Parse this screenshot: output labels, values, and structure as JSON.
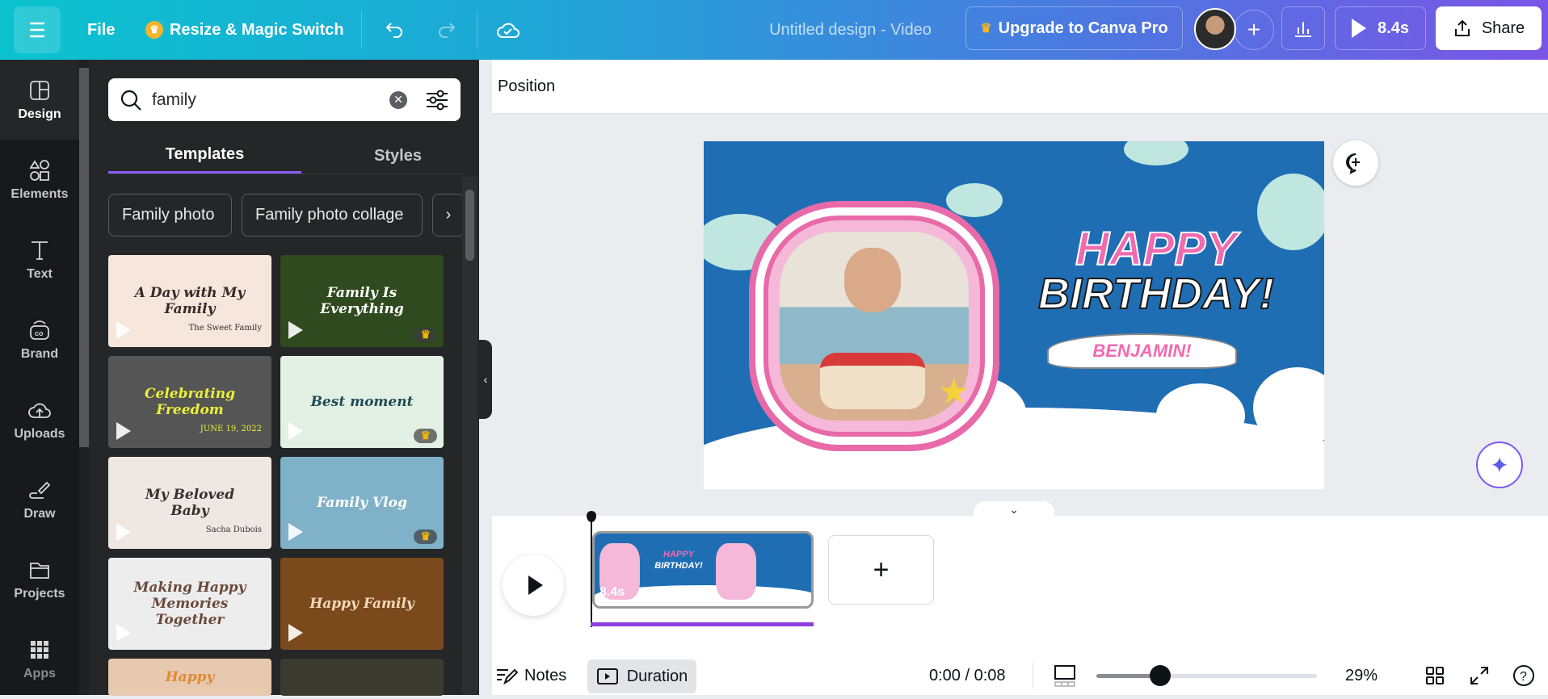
{
  "topbar": {
    "menu_icon": "hamburger-icon",
    "file": "File",
    "resize": "Resize & Magic Switch",
    "title": "Untitled design - Video",
    "upgrade": "Upgrade to Canva Pro",
    "play_duration": "8.4s",
    "share": "Share"
  },
  "rail": [
    {
      "label": "Design",
      "icon": "design-icon"
    },
    {
      "label": "Elements",
      "icon": "elements-icon"
    },
    {
      "label": "Text",
      "icon": "text-icon"
    },
    {
      "label": "Brand",
      "icon": "brand-icon"
    },
    {
      "label": "Uploads",
      "icon": "uploads-icon"
    },
    {
      "label": "Draw",
      "icon": "draw-icon"
    },
    {
      "label": "Projects",
      "icon": "projects-icon"
    },
    {
      "label": "Apps",
      "icon": "apps-icon"
    }
  ],
  "panel": {
    "search_value": "family",
    "tabs": [
      "Templates",
      "Styles"
    ],
    "active_tab": "Templates",
    "chips": [
      "Family photo",
      "Family photo collage"
    ],
    "templates": [
      {
        "title": "A Day with My Family",
        "sub": "The Sweet Family",
        "bg": "#f6e6dc",
        "color": "#3a2a2a",
        "premium": false
      },
      {
        "title": "Family Is Everything",
        "sub": "",
        "bg": "#2f4a1e",
        "color": "#ffffff",
        "premium": true
      },
      {
        "title": "Celebrating Freedom",
        "sub": "JUNE 19, 2022",
        "bg": "#555555",
        "color": "#e9f03a",
        "premium": false
      },
      {
        "title": "Best moment",
        "sub": "",
        "bg": "#e3f0e4",
        "color": "#1f4c57",
        "premium": true
      },
      {
        "title": "My Beloved Baby",
        "sub": "Sacha Dubois",
        "bg": "#efe8e2",
        "color": "#3a3030",
        "premium": false
      },
      {
        "title": "Family Vlog",
        "sub": "",
        "bg": "#7fb2c8",
        "color": "#ffffff",
        "premium": true
      },
      {
        "title": "Making Happy Memories Together",
        "sub": "",
        "bg": "#ededed",
        "color": "#6b4a3a",
        "premium": false
      },
      {
        "title": "Happy Family",
        "sub": "",
        "bg": "#7a4a1c",
        "color": "#f3d9b8",
        "premium": false
      },
      {
        "title": "Happy",
        "sub": "",
        "bg": "#e7c9b0",
        "color": "#e08a30",
        "premium": false
      },
      {
        "title": "",
        "sub": "",
        "bg": "#3a3a30",
        "color": "#ffffff",
        "premium": false
      }
    ]
  },
  "editor": {
    "position": "Position"
  },
  "design": {
    "headline1": "HAPPY",
    "headline2": "BIRTHDAY!",
    "name": "BENJAMIN!",
    "bg": "#1f6eb4",
    "pink": "#f06ab0"
  },
  "timeline": {
    "clip_duration": "8.4s"
  },
  "bottombar": {
    "notes": "Notes",
    "duration": "Duration",
    "time": "0:00 / 0:08",
    "zoom": "29%",
    "zoom_level_percent": 29
  }
}
